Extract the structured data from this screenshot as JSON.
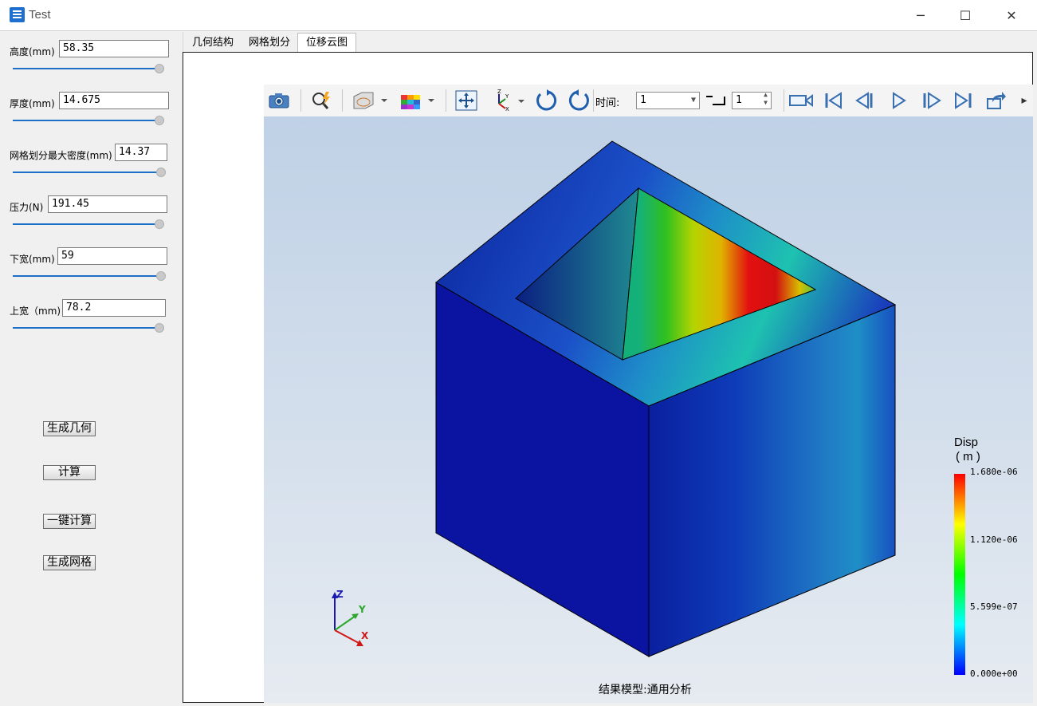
{
  "window": {
    "title": "Test",
    "minimize": "─",
    "maximize": "☐",
    "close": "✕"
  },
  "params": [
    {
      "label": "高度(mm)",
      "value": "58.35",
      "slider": 0.97
    },
    {
      "label": "厚度(mm)",
      "value": "14.675",
      "slider": 0.97
    },
    {
      "label": "网格划分最大密度(mm)",
      "value": "14.37",
      "slider": 0.98
    },
    {
      "label": "压力(N)",
      "value": "191.45",
      "slider": 0.97
    },
    {
      "label": "下宽(mm)",
      "value": "59",
      "slider": 0.98
    },
    {
      "label": "上宽（mm)",
      "value": "78.2",
      "slider": 0.97
    }
  ],
  "buttons": {
    "generate_geometry": "生成几何",
    "compute": "计算",
    "one_click_compute": "一键计算",
    "generate_mesh": "生成网格"
  },
  "tabs": [
    {
      "label": "几何结构",
      "active": false
    },
    {
      "label": "网格划分",
      "active": false
    },
    {
      "label": "位移云图",
      "active": true
    }
  ],
  "toolbar": {
    "icons": [
      "camera-icon",
      "query-icon",
      "display-mode-icon",
      "color-cube-icon",
      "fit-view-icon",
      "axes-icon",
      "rotate-left-icon",
      "rotate-right-icon"
    ],
    "time_label": "时间:",
    "time_value": "1",
    "step_value": "1",
    "playback_icons": [
      "record-icon",
      "first-frame-icon",
      "previous-frame-icon",
      "play-icon",
      "next-frame-icon",
      "last-frame-icon",
      "export-icon",
      "more-icon"
    ]
  },
  "legend": {
    "title": "Disp",
    "unit": "( m )",
    "ticks": [
      "1.680e-06",
      "1.120e-06",
      "5.599e-07",
      "0.000e+00"
    ],
    "colors": [
      "#ff0000",
      "#ffff00",
      "#00ff00",
      "#00ffff",
      "#0000ff"
    ]
  },
  "triad": {
    "z": "Z",
    "y": "Y",
    "x": "X"
  },
  "footer": "结果模型:通用分析"
}
